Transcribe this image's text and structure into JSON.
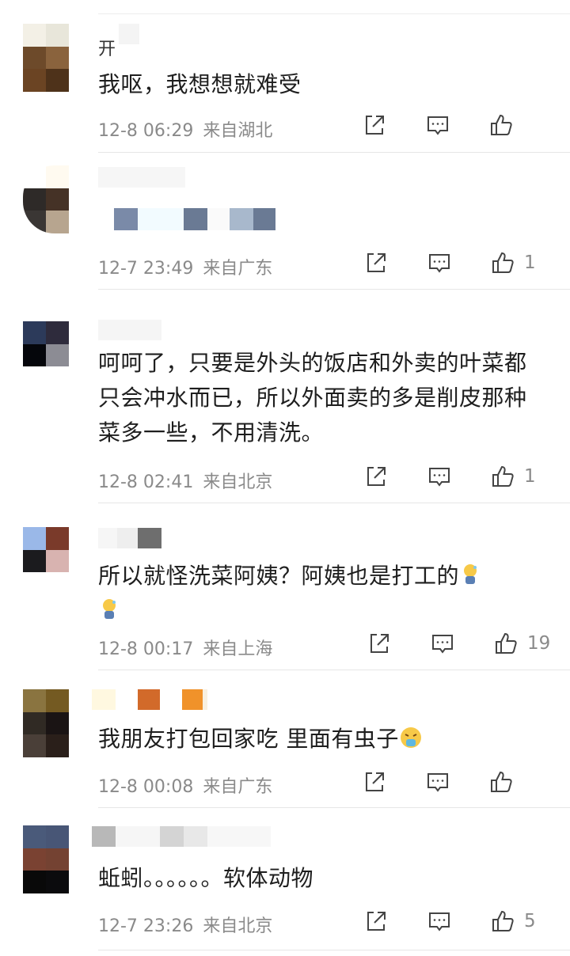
{
  "comments": [
    {
      "name": "开",
      "text": "我呕，我想想就难受",
      "time": "12-8 06:29",
      "location": "来自湖北",
      "likes": "",
      "avatar": [
        "#f3f0e6",
        "#e8e6da",
        "#6d4a2a",
        "#8a633d",
        "#6b4423",
        "#4e321a"
      ]
    },
    {
      "name": "",
      "text": "",
      "time": "12-7 23:49",
      "location": "来自广东",
      "likes": "1",
      "avatar": [
        "#ffffff",
        "#fffaf0",
        "#2e2a28",
        "#453226",
        "#3a3634",
        "#b7a58f"
      ]
    },
    {
      "name": "",
      "text": "呵呵了，只要是外头的饭店和外卖的叶菜都只会冲水而已，所以外面卖的多是削皮那种菜多一些，不用清洗。",
      "time": "12-8 02:41",
      "location": "来自北京",
      "likes": "1",
      "avatar": [
        "#2c3a5a",
        "#2e2b3c",
        "#05060b",
        "#8c8c94",
        "#ffffff",
        "#ffffff"
      ]
    },
    {
      "name": "",
      "text": "所以就怪洗菜阿姨？阿姨也是打工的",
      "time": "12-8 00:17",
      "location": "来自上海",
      "likes": "19",
      "avatar": [
        "#9ab8e8",
        "#7a3a2a",
        "#1b1b1e",
        "#d8b3b0",
        "#ffffff",
        "#ffffff"
      ]
    },
    {
      "name": "",
      "text": "我朋友打包回家吃 里面有虫子",
      "time": "12-8 00:08",
      "location": "来自广东",
      "likes": "",
      "avatar": [
        "#8a7440",
        "#745a22",
        "#302a24",
        "#1a1414",
        "#4a3f38",
        "#2a1f1a"
      ]
    },
    {
      "name": "",
      "text": "蚯蚓。。。。。。软体动物",
      "time": "12-7 23:26",
      "location": "来自北京",
      "likes": "5",
      "avatar": [
        "#4a5a7a",
        "#485676",
        "#7a4232",
        "#744232",
        "#090909",
        "#0b0b0d"
      ]
    }
  ],
  "icons": {
    "share": "share-icon",
    "comment": "comment-icon",
    "like": "thumbs-up-icon"
  }
}
